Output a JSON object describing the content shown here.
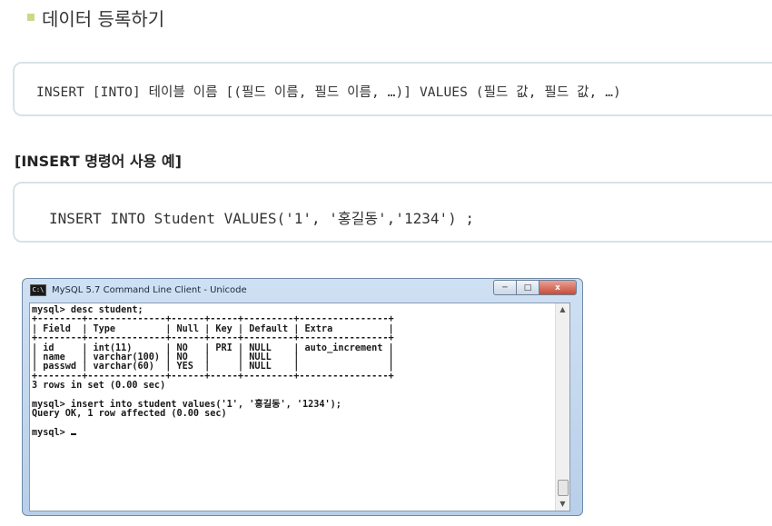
{
  "section": {
    "title": "데이터 등록하기"
  },
  "syntax_box": {
    "code": "INSERT [INTO] 테이블 이름 [(필드 이름, 필드 이름, …)] VALUES (필드 값, 필드 값, …)"
  },
  "example": {
    "title": "[INSERT 명령어 사용 예]",
    "code": "INSERT INTO Student VALUES('1', '홍길동','1234') ;"
  },
  "window": {
    "title": "MySQL 5.7 Command Line Client - Unicode",
    "icon": "console-icon",
    "buttons": {
      "minimize": "─",
      "maximize": "□",
      "close": "x"
    },
    "console_lines": [
      "mysql> desc student;",
      "+--------+--------------+------+-----+---------+----------------+",
      "| Field  | Type         | Null | Key | Default | Extra          |",
      "+--------+--------------+------+-----+---------+----------------+",
      "| id     | int(11)      | NO   | PRI | NULL    | auto_increment |",
      "| name   | varchar(100) | NO   |     | NULL    |                |",
      "| passwd | varchar(60)  | YES  |     | NULL    |                |",
      "+--------+--------------+------+-----+---------+----------------+",
      "3 rows in set (0.00 sec)",
      "",
      "mysql> insert into student values('1', '홍길동', '1234');",
      "Query OK, 1 row affected (0.00 sec)",
      "",
      "mysql> "
    ]
  }
}
